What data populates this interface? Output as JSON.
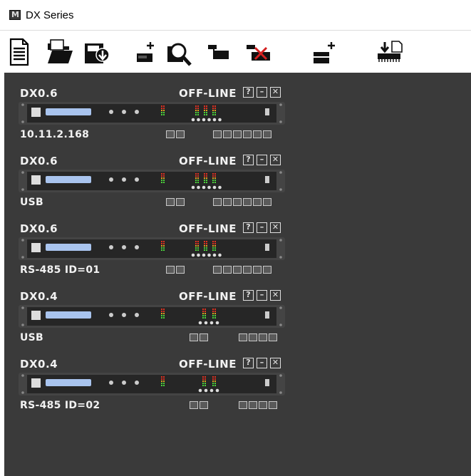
{
  "app": {
    "title": "DX Series",
    "logo_icon": "martin-audio-logo-icon"
  },
  "toolbar": {
    "buttons": [
      {
        "name": "new-file-button",
        "icon": "new-document-icon"
      },
      {
        "name": "open-file-button",
        "icon": "open-folder-icon"
      },
      {
        "name": "save-file-button",
        "icon": "save-disk-icon"
      },
      {
        "name": "add-device-button",
        "icon": "add-device-icon"
      },
      {
        "name": "discover-devices-button",
        "icon": "magnifier-icon"
      },
      {
        "name": "link-devices-button",
        "icon": "link-devices-icon"
      },
      {
        "name": "remove-device-button",
        "icon": "remove-device-icon"
      },
      {
        "name": "add-group-button",
        "icon": "add-group-icon"
      },
      {
        "name": "firmware-update-button",
        "icon": "firmware-update-icon"
      }
    ]
  },
  "colors": {
    "panel_bg": "#3a3a3a",
    "text": "#f2f2f2",
    "rack": "#262626",
    "lcd": "#a9c4ee",
    "meter_green": "#4ad23a",
    "meter_amber": "#e0a020",
    "meter_red": "#e03020"
  },
  "devices": [
    {
      "model": "DX0.6",
      "status": "OFF-LINE",
      "connection": "10.11.2.168",
      "inputs": 2,
      "outputs": 6
    },
    {
      "model": "DX0.6",
      "status": "OFF-LINE",
      "connection": "USB",
      "inputs": 2,
      "outputs": 6
    },
    {
      "model": "DX0.6",
      "status": "OFF-LINE",
      "connection": "RS-485 ID=01",
      "inputs": 2,
      "outputs": 6
    },
    {
      "model": "DX0.4",
      "status": "OFF-LINE",
      "connection": "USB",
      "inputs": 2,
      "outputs": 4
    },
    {
      "model": "DX0.4",
      "status": "OFF-LINE",
      "connection": "RS-485 ID=02",
      "inputs": 2,
      "outputs": 4
    }
  ],
  "window_buttons": {
    "help": "?",
    "minimize": "–",
    "close": "✕"
  }
}
